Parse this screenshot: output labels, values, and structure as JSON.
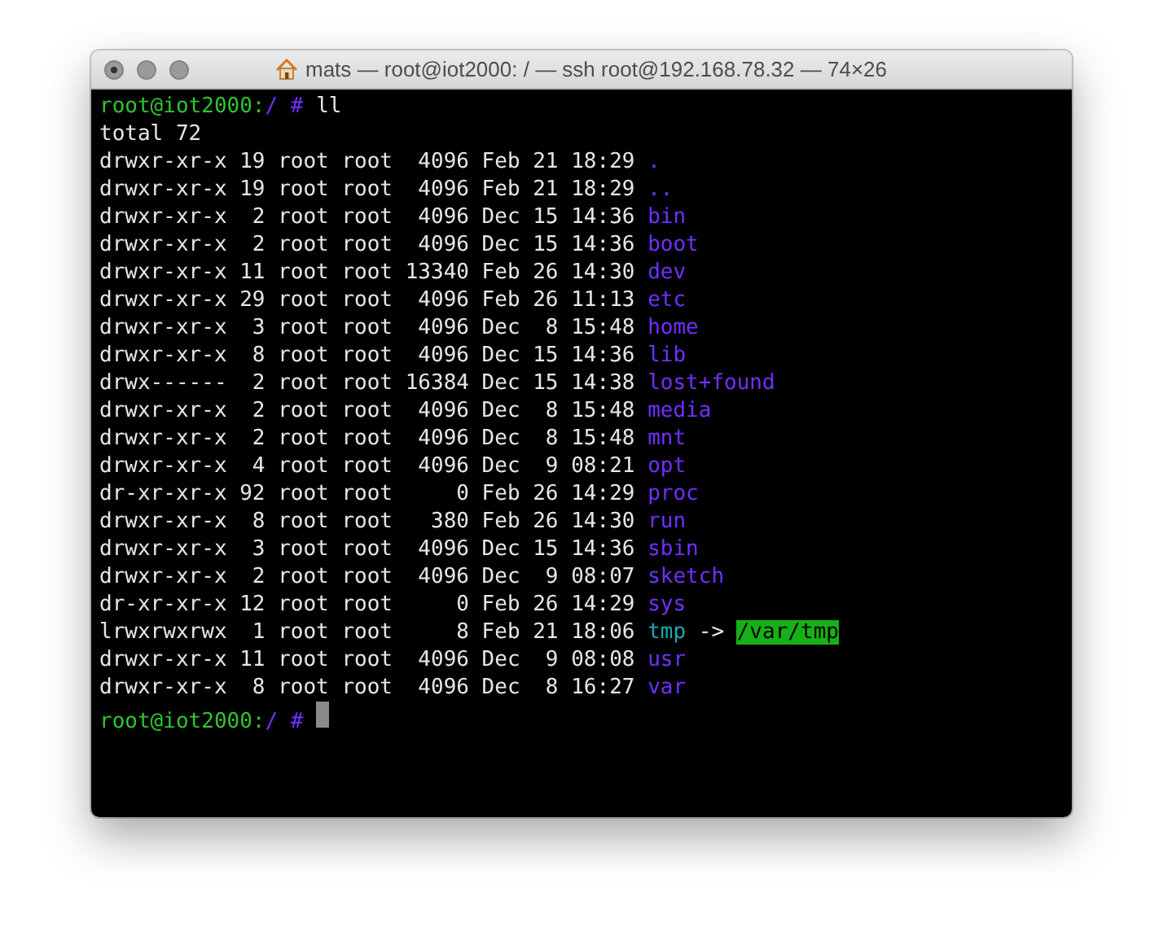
{
  "window": {
    "title": "mats — root@iot2000: / — ssh root@192.168.78.32 — 74×26"
  },
  "lines": [
    {
      "kind": "prompt",
      "user": "root@iot2000",
      "separator": ":",
      "path": "/",
      "symbol": "#",
      "command": "ll"
    },
    {
      "kind": "text",
      "text": "total 72"
    },
    {
      "kind": "entry",
      "info": "drwxr-xr-x 19 root root  4096 Feb 21 18:29",
      "name": ".",
      "color": "#7030ff"
    },
    {
      "kind": "entry",
      "info": "drwxr-xr-x 19 root root  4096 Feb 21 18:29",
      "name": "..",
      "color": "#7030ff"
    },
    {
      "kind": "entry",
      "info": "drwxr-xr-x  2 root root  4096 Dec 15 14:36",
      "name": "bin",
      "color": "#7030ff"
    },
    {
      "kind": "entry",
      "info": "drwxr-xr-x  2 root root  4096 Dec 15 14:36",
      "name": "boot",
      "color": "#7030ff"
    },
    {
      "kind": "entry",
      "info": "drwxr-xr-x 11 root root 13340 Feb 26 14:30",
      "name": "dev",
      "color": "#7030ff"
    },
    {
      "kind": "entry",
      "info": "drwxr-xr-x 29 root root  4096 Feb 26 11:13",
      "name": "etc",
      "color": "#7030ff"
    },
    {
      "kind": "entry",
      "info": "drwxr-xr-x  3 root root  4096 Dec  8 15:48",
      "name": "home",
      "color": "#7030ff"
    },
    {
      "kind": "entry",
      "info": "drwxr-xr-x  8 root root  4096 Dec 15 14:36",
      "name": "lib",
      "color": "#7030ff"
    },
    {
      "kind": "entry",
      "info": "drwx------  2 root root 16384 Dec 15 14:38",
      "name": "lost+found",
      "color": "#7030ff"
    },
    {
      "kind": "entry",
      "info": "drwxr-xr-x  2 root root  4096 Dec  8 15:48",
      "name": "media",
      "color": "#7030ff"
    },
    {
      "kind": "entry",
      "info": "drwxr-xr-x  2 root root  4096 Dec  8 15:48",
      "name": "mnt",
      "color": "#7030ff"
    },
    {
      "kind": "entry",
      "info": "drwxr-xr-x  4 root root  4096 Dec  9 08:21",
      "name": "opt",
      "color": "#7030ff"
    },
    {
      "kind": "entry",
      "info": "dr-xr-xr-x 92 root root     0 Feb 26 14:29",
      "name": "proc",
      "color": "#7030ff"
    },
    {
      "kind": "entry",
      "info": "drwxr-xr-x  8 root root   380 Feb 26 14:30",
      "name": "run",
      "color": "#7030ff"
    },
    {
      "kind": "entry",
      "info": "drwxr-xr-x  3 root root  4096 Dec 15 14:36",
      "name": "sbin",
      "color": "#7030ff"
    },
    {
      "kind": "entry",
      "info": "drwxr-xr-x  2 root root  4096 Dec  9 08:07",
      "name": "sketch",
      "color": "#7030ff"
    },
    {
      "kind": "entry",
      "info": "dr-xr-xr-x 12 root root     0 Feb 26 14:29",
      "name": "sys",
      "color": "#7030ff"
    },
    {
      "kind": "entry",
      "info": "lrwxrwxrwx  1 root root     8 Feb 21 18:06",
      "name": "tmp",
      "color": "#18a8b0",
      "arrow": "->",
      "target": "/var/tmp"
    },
    {
      "kind": "entry",
      "info": "drwxr-xr-x 11 root root  4096 Dec  9 08:08",
      "name": "usr",
      "color": "#7030ff"
    },
    {
      "kind": "entry",
      "info": "drwxr-xr-x  8 root root  4096 Dec  8 16:27",
      "name": "var",
      "color": "#7030ff"
    },
    {
      "kind": "prompt",
      "user": "root@iot2000",
      "separator": ":",
      "path": "/",
      "symbol": "#",
      "cursor": true
    }
  ]
}
